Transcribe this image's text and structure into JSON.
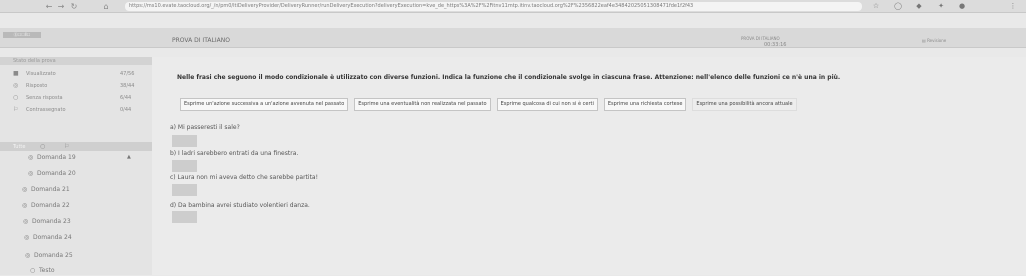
{
  "browser": {
    "url": "https://ms10.evate.taocloud.org/_/n/pm0/ltiDeliveryProvider/DeliveryRunner/runDeliveryExecution?deliveryExecution=kve_de_https%3A%2F%2Fitnv11mtp.itinv.taocloud.org%2F%2356822eaf4e34842025051308471fde1f2f43"
  },
  "header": {
    "logo": "Ⓢ☐☐Ⅱ☐",
    "test_title": "PROVA DI ITALIANO",
    "timer_label": "PROVA DI ITALIANO",
    "timer_value": "00:33:16",
    "review_label": "Revisione"
  },
  "sidebar": {
    "status_header": "Stato della prova",
    "stats": [
      {
        "icon": "■",
        "label": "Visualizzato",
        "count": "47/56"
      },
      {
        "icon": "◎",
        "label": "Risposto",
        "count": "38/44"
      },
      {
        "icon": "○",
        "label": "Senza risposta",
        "count": "6/44"
      },
      {
        "icon": "⚐",
        "label": "Contrassegnato",
        "count": "0/44"
      }
    ],
    "filter_label": "Tutte",
    "questions": [
      {
        "icon": "◎",
        "label": "Domanda 19"
      },
      {
        "icon": "◎",
        "label": "Domanda 20"
      },
      {
        "icon": "◎",
        "label": "Domanda 21"
      },
      {
        "icon": "◎",
        "label": "Domanda 22"
      },
      {
        "icon": "◎",
        "label": "Domanda 23"
      },
      {
        "icon": "◎",
        "label": "Domanda 24"
      },
      {
        "icon": "◎",
        "label": "Domanda 25"
      },
      {
        "icon": "○",
        "label": "Testo"
      }
    ]
  },
  "main": {
    "instruction": "Nelle frasi che seguono il modo condizionale è utilizzato con diverse funzioni. Indica la funzione che il condizionale svolge in ciascuna frase. Attenzione: nell'elenco delle funzioni ce n'è una in più.",
    "options": [
      "Esprime un'azione successiva a un'azione avvenuta nel passato",
      "Esprime una eventualità non realizzata nel passato",
      "Esprime qualcosa di cui non si è certi",
      "Esprime una richiesta cortese",
      "Esprime una possibilità ancora attuale"
    ],
    "sentences": [
      "a) Mi passeresti il sale?",
      "b) I ladri sarebbero entrati da una finestra.",
      "c) Laura non mi aveva detto che sarebbe partita!",
      "d) Da bambina avrei studiato volentieri danza."
    ]
  }
}
